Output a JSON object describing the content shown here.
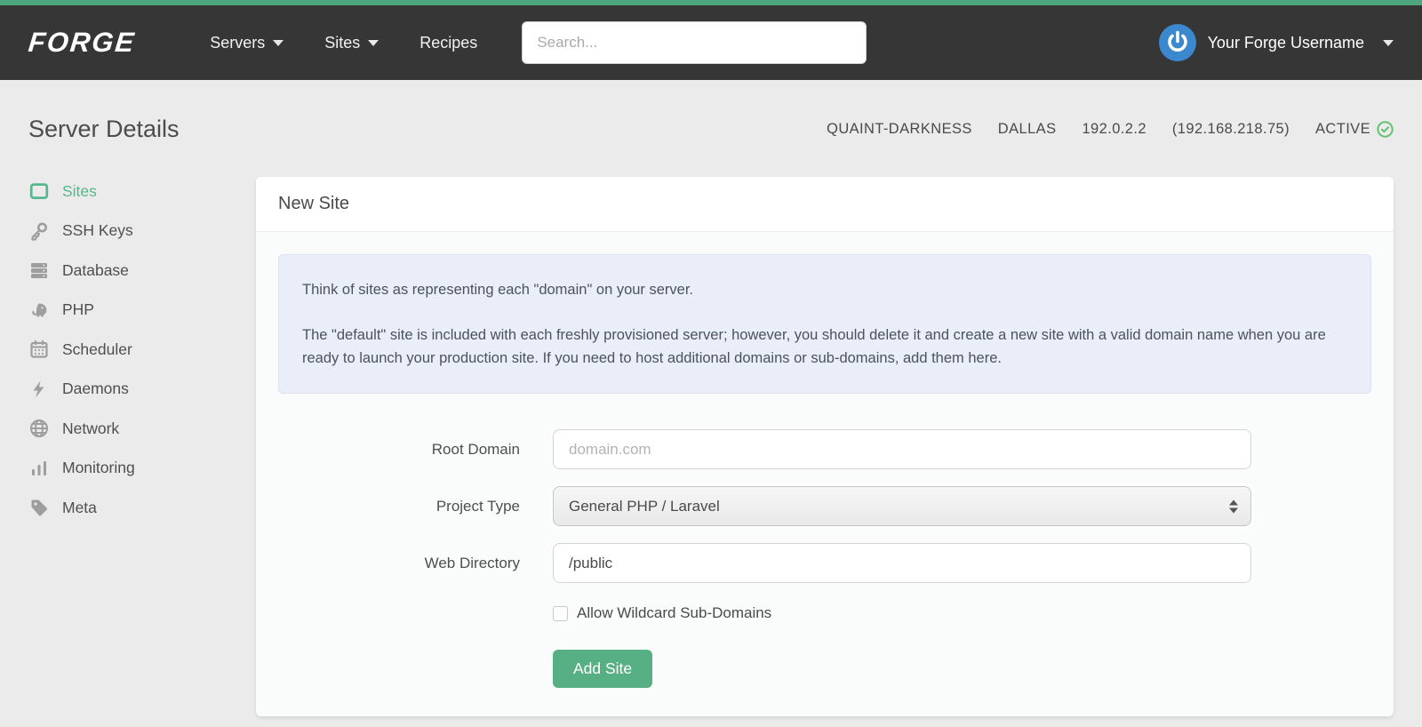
{
  "brand": {
    "logo": "FORGE"
  },
  "colors": {
    "accent_green": "#4ea77e",
    "button_green": "#57b083",
    "active_green": "#56b78c",
    "navbar_bg": "#363636",
    "avatar_blue": "#3c88cf",
    "alert_bg": "#e9eef8",
    "page_bg": "#ebebeb",
    "status_green": "#5fc06e"
  },
  "navbar": {
    "items": [
      {
        "label": "Servers",
        "has_caret": true
      },
      {
        "label": "Sites",
        "has_caret": true
      },
      {
        "label": "Recipes",
        "has_caret": false
      }
    ],
    "search_placeholder": "Search...",
    "username": "Your Forge Username"
  },
  "page": {
    "title": "Server Details"
  },
  "server_meta": {
    "name": "QUAINT-DARKNESS",
    "region": "DALLAS",
    "ip": "192.0.2.2",
    "private_ip": "(192.168.218.75)",
    "status": "ACTIVE"
  },
  "sidebar": {
    "items": [
      {
        "label": "Sites",
        "icon": "window-icon",
        "active": true
      },
      {
        "label": "SSH Keys",
        "icon": "key-icon",
        "active": false
      },
      {
        "label": "Database",
        "icon": "database-icon",
        "active": false
      },
      {
        "label": "PHP",
        "icon": "php-elephant-icon",
        "active": false
      },
      {
        "label": "Scheduler",
        "icon": "calendar-icon",
        "active": false
      },
      {
        "label": "Daemons",
        "icon": "lightning-icon",
        "active": false
      },
      {
        "label": "Network",
        "icon": "globe-icon",
        "active": false
      },
      {
        "label": "Monitoring",
        "icon": "bar-chart-icon",
        "active": false
      },
      {
        "label": "Meta",
        "icon": "tag-icon",
        "active": false
      }
    ]
  },
  "card": {
    "title": "New Site",
    "alert": {
      "p1": "Think of sites as representing each \"domain\" on your server.",
      "p2": "The \"default\" site is included with each freshly provisioned server; however, you should delete it and create a new site with a valid domain name when you are ready to launch your production site. If you need to host additional domains or sub-domains, add them here."
    },
    "fields": {
      "root_domain": {
        "label": "Root Domain",
        "placeholder": "domain.com",
        "value": ""
      },
      "project_type": {
        "label": "Project Type",
        "selected": "General PHP / Laravel"
      },
      "web_directory": {
        "label": "Web Directory",
        "value": "/public"
      },
      "wildcard": {
        "label": "Allow Wildcard Sub-Domains",
        "checked": false
      }
    },
    "submit_label": "Add Site"
  }
}
